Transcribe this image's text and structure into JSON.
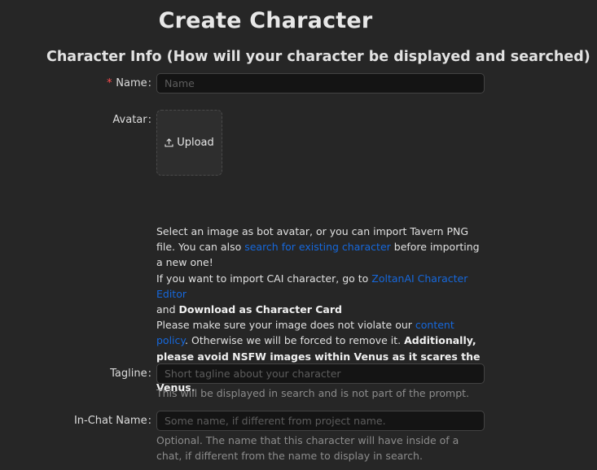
{
  "page": {
    "title": "Create Character",
    "section_title": "Character Info (How will your character be displayed and searched)"
  },
  "name_field": {
    "required_mark": "*",
    "label": "Name",
    "colon": ":",
    "placeholder": "Name",
    "value": ""
  },
  "avatar": {
    "label": "Avatar",
    "colon": ":",
    "upload_label": "Upload",
    "upload_icon": "upload-icon"
  },
  "avatar_help": {
    "t1": "Select an image as bot avatar, or you can import Tavern PNG file. You can also ",
    "link1": "search for existing character",
    "t2": " before importing a new one!",
    "t3": "If you want to import CAI character, go to ",
    "link2": "ZoltanAI Character Editor",
    "t4": "and ",
    "b1": "Download as Character Card",
    "t5": "Please make sure your image does not violate our ",
    "link3": "content policy",
    "t6": ". Otherwise we will be forced to remove it. ",
    "b2": "Additionally, please avoid NSFW images within Venus as it scares the card companies. They may need to be obscured within Venus."
  },
  "tagline": {
    "label": "Tagline",
    "colon": ":",
    "placeholder": "Short tagline about your character",
    "value": "",
    "note": "This will be displayed in search and is not part of the prompt."
  },
  "in_chat_name": {
    "label": "In-Chat Name",
    "colon": ":",
    "placeholder": "Some name, if different from project name.",
    "value": "",
    "note": "Optional. The name that this character will have inside of a chat, if different from the name to display in search."
  },
  "colors": {
    "background": "#262626",
    "input_bg": "#141414",
    "link": "#1668dc",
    "required": "#ff4d4f"
  }
}
